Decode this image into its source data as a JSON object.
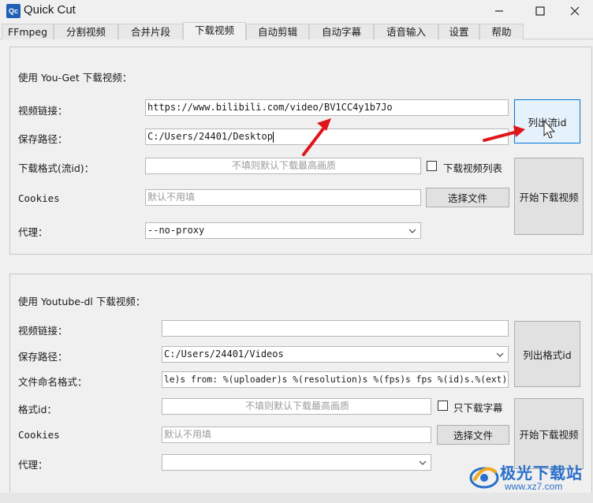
{
  "window": {
    "title": "Quick Cut",
    "icon_text": "Qc"
  },
  "tabs": [
    {
      "label": "FFmpeg"
    },
    {
      "label": "分割视频"
    },
    {
      "label": "合并片段"
    },
    {
      "label": "下载视频"
    },
    {
      "label": "自动剪辑"
    },
    {
      "label": "自动字幕"
    },
    {
      "label": "语音输入"
    },
    {
      "label": "设置"
    },
    {
      "label": "帮助"
    }
  ],
  "active_tab": "下载视频",
  "youget": {
    "title": "使用 You-Get 下载视频：",
    "url_label": "视频链接：",
    "url_value": "https://www.bilibili.com/video/BV1CC4y1b7Jo",
    "path_label": "保存路径：",
    "path_value": "C:/Users/24401/Desktop",
    "format_label": "下载格式(流id)：",
    "format_placeholder": "不填则默认下载最高画质",
    "playlist_label": "下载视频列表",
    "cookies_label": "Cookies",
    "cookies_placeholder": "默认不用填",
    "choose_file": "选择文件",
    "proxy_label": "代理：",
    "proxy_value": "--no-proxy",
    "list_button": "列出流id",
    "start_button": "开始下载视频"
  },
  "ytdl": {
    "title": "使用 Youtube-dl 下载视频：",
    "url_label": "视频链接：",
    "url_value": "",
    "path_label": "保存路径：",
    "path_value": "C:/Users/24401/Videos",
    "naming_label": "文件命名格式：",
    "naming_value": "le)s from: %(uploader)s %(resolution)s %(fps)s fps %(id)s.%(ext)s",
    "format_label": "格式id：",
    "format_placeholder": "不填则默认下载最高画质",
    "subs_label": "只下载字幕",
    "cookies_label": "Cookies",
    "cookies_placeholder": "默认不用填",
    "choose_file": "选择文件",
    "proxy_label": "代理：",
    "proxy_value": "",
    "list_button": "列出格式id",
    "start_button": "开始下载视频"
  },
  "watermark": {
    "title": "极光下载站",
    "url": "www.xz7.com"
  },
  "colors": {
    "accent": "#0078d7",
    "annotation_arrow": "#e0151a",
    "watermark": "#2a6fc9"
  }
}
